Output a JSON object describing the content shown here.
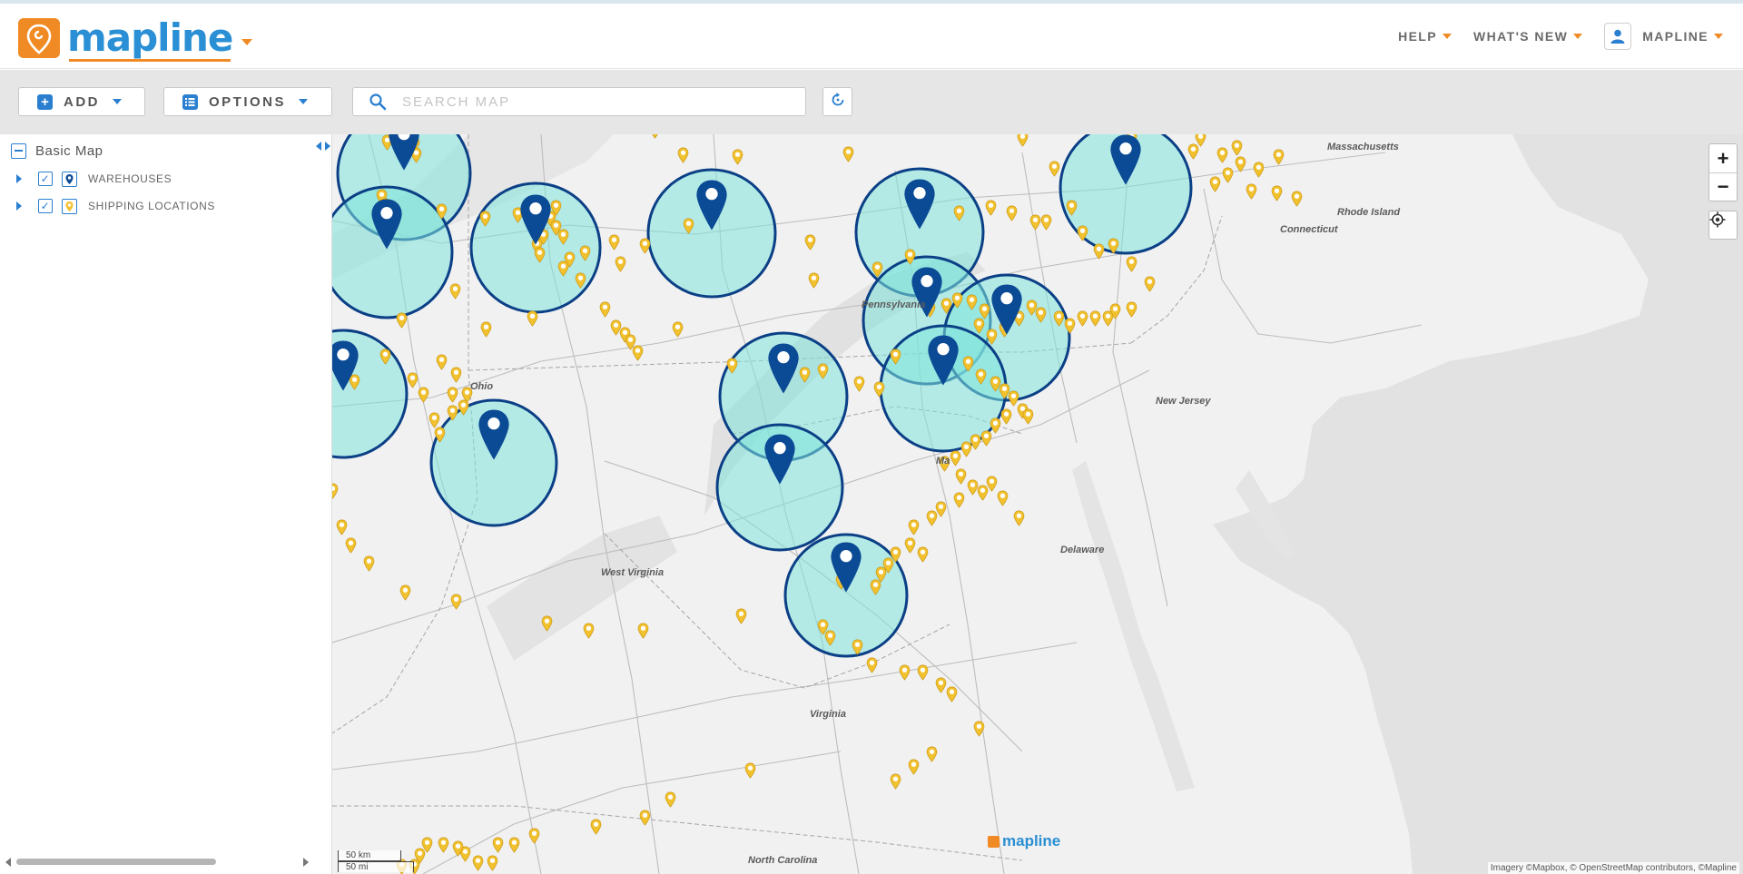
{
  "app": {
    "brand": "mapline"
  },
  "nav": {
    "help": "HELP",
    "whats_new": "WHAT'S NEW",
    "account": "MAPLINE"
  },
  "toolbar": {
    "add_label": "ADD",
    "options_label": "OPTIONS",
    "search_placeholder": "SEARCH MAP"
  },
  "sidebar": {
    "root_label": "Basic Map",
    "layers": [
      {
        "label": "WAREHOUSES",
        "checked": true,
        "icon": "warehouse-pin-icon"
      },
      {
        "label": "SHIPPING LOCATIONS",
        "checked": true,
        "icon": "shipping-pin-icon"
      }
    ]
  },
  "map": {
    "labels": {
      "massachusetts": "Massachusetts",
      "rhode_island": "Rhode Island",
      "connecticut": "Connecticut",
      "pennsylvania": "Pennsylvania",
      "ohio": "Ohio",
      "new_jersey": "New Jersey",
      "maryland": "Ma",
      "delaware": "Delaware",
      "west_virginia": "West Virginia",
      "virginia": "Virginia",
      "north_carolina": "North Carolina"
    },
    "scale_km": "50 km",
    "scale_mi": "50 mi",
    "watermark": "mapline",
    "attribution": "Imagery ©Mapbox, © OpenStreetMap contributors, ©Mapline",
    "zoom_in": "+",
    "zoom_out": "−"
  },
  "colors": {
    "radius_fill": "#7fe3dc",
    "radius_stroke": "#0b3f86",
    "warehouse_pin": "#0b4a94",
    "shipping_pin": "#f2c12e",
    "accent_orange": "#f08a24",
    "accent_blue": "#2a7fd0"
  }
}
